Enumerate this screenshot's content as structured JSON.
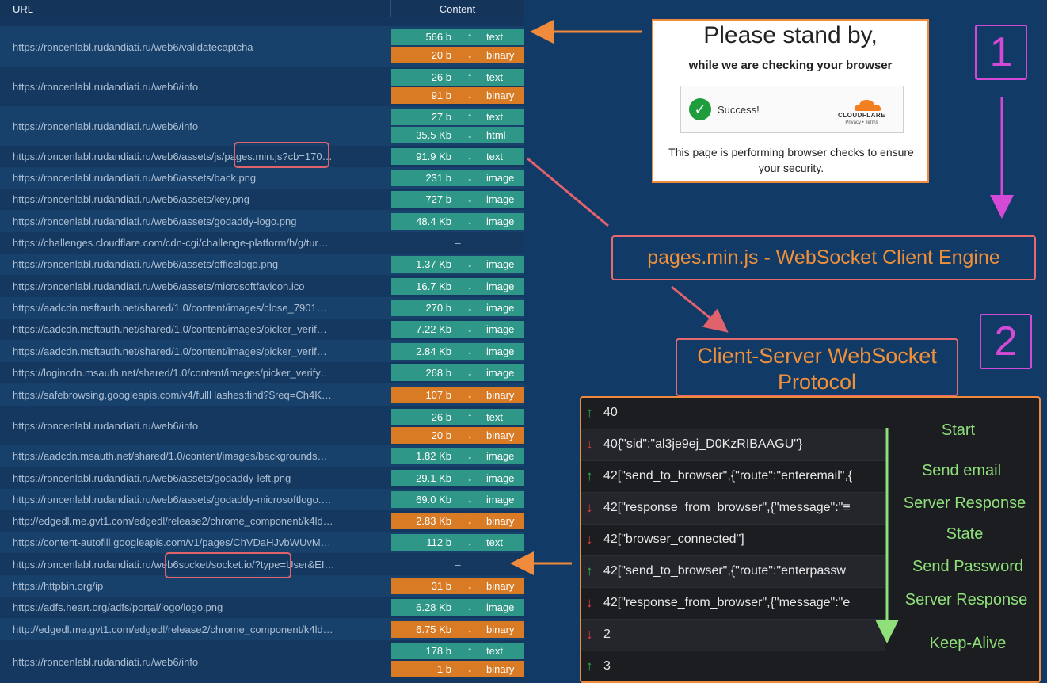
{
  "columns": {
    "url": "URL",
    "content": "Content"
  },
  "rows": [
    {
      "url": "https://roncenlabl.rudandiati.ru/web6/validatecaptcha",
      "chips": [
        {
          "size": "566 b",
          "dir": "up",
          "type": "text"
        },
        {
          "size": "20 b",
          "dir": "down",
          "type": "binary"
        }
      ]
    },
    {
      "url": "https://roncenlabl.rudandiati.ru/web6/info",
      "chips": [
        {
          "size": "26 b",
          "dir": "up",
          "type": "text"
        },
        {
          "size": "91 b",
          "dir": "down",
          "type": "binary"
        }
      ]
    },
    {
      "url": "https://roncenlabl.rudandiati.ru/web6/info",
      "chips": [
        {
          "size": "27 b",
          "dir": "up",
          "type": "text"
        },
        {
          "size": "35.5 Kb",
          "dir": "down",
          "type": "html"
        }
      ]
    },
    {
      "url": "https://roncenlabl.rudandiati.ru/web6/assets/js/pages.min.js?cb=170…",
      "chips": [
        {
          "size": "91.9 Kb",
          "dir": "down",
          "type": "text"
        }
      ]
    },
    {
      "url": "https://roncenlabl.rudandiati.ru/web6/assets/back.png",
      "chips": [
        {
          "size": "231 b",
          "dir": "down",
          "type": "image"
        }
      ]
    },
    {
      "url": "https://roncenlabl.rudandiati.ru/web6/assets/key.png",
      "chips": [
        {
          "size": "727 b",
          "dir": "down",
          "type": "image"
        }
      ]
    },
    {
      "url": "https://roncenlabl.rudandiati.ru/web6/assets/godaddy-logo.png",
      "chips": [
        {
          "size": "48.4 Kb",
          "dir": "down",
          "type": "image"
        }
      ]
    },
    {
      "url": "https://challenges.cloudflare.com/cdn-cgi/challenge-platform/h/g/tur…",
      "chips": [],
      "dash": "–"
    },
    {
      "url": "https://roncenlabl.rudandiati.ru/web6/assets/officelogo.png",
      "chips": [
        {
          "size": "1.37 Kb",
          "dir": "down",
          "type": "image"
        }
      ]
    },
    {
      "url": "https://roncenlabl.rudandiati.ru/web6/assets/microsoftfavicon.ico",
      "chips": [
        {
          "size": "16.7 Kb",
          "dir": "down",
          "type": "image"
        }
      ]
    },
    {
      "url": "https://aadcdn.msftauth.net/shared/1.0/content/images/close_7901…",
      "chips": [
        {
          "size": "270 b",
          "dir": "down",
          "type": "image"
        }
      ]
    },
    {
      "url": "https://aadcdn.msftauth.net/shared/1.0/content/images/picker_verif…",
      "chips": [
        {
          "size": "7.22 Kb",
          "dir": "down",
          "type": "image"
        }
      ]
    },
    {
      "url": "https://aadcdn.msftauth.net/shared/1.0/content/images/picker_verif…",
      "chips": [
        {
          "size": "2.84 Kb",
          "dir": "down",
          "type": "image"
        }
      ]
    },
    {
      "url": "https://logincdn.msauth.net/shared/1.0/content/images/picker_verify…",
      "chips": [
        {
          "size": "268 b",
          "dir": "down",
          "type": "image"
        }
      ]
    },
    {
      "url": "https://safebrowsing.googleapis.com/v4/fullHashes:find?$req=Ch4K…",
      "chips": [
        {
          "size": "107 b",
          "dir": "down",
          "type": "binary"
        }
      ]
    },
    {
      "url": "https://roncenlabl.rudandiati.ru/web6/info",
      "chips": [
        {
          "size": "26 b",
          "dir": "up",
          "type": "text"
        },
        {
          "size": "20 b",
          "dir": "down",
          "type": "binary"
        }
      ]
    },
    {
      "url": "https://aadcdn.msauth.net/shared/1.0/content/images/backgrounds…",
      "chips": [
        {
          "size": "1.82 Kb",
          "dir": "down",
          "type": "image"
        }
      ]
    },
    {
      "url": "https://roncenlabl.rudandiati.ru/web6/assets/godaddy-left.png",
      "chips": [
        {
          "size": "29.1 Kb",
          "dir": "down",
          "type": "image"
        }
      ]
    },
    {
      "url": "https://roncenlabl.rudandiati.ru/web6/assets/godaddy-microsoftlogo.…",
      "chips": [
        {
          "size": "69.0 Kb",
          "dir": "down",
          "type": "image"
        }
      ]
    },
    {
      "url": "http://edgedl.me.gvt1.com/edgedl/release2/chrome_component/k4ld…",
      "chips": [
        {
          "size": "2.83 Kb",
          "dir": "down",
          "type": "binary"
        }
      ]
    },
    {
      "url": "https://content-autofill.googleapis.com/v1/pages/ChVDaHJvbWUvM…",
      "chips": [
        {
          "size": "112 b",
          "dir": "down",
          "type": "text"
        }
      ]
    },
    {
      "url": "https://roncenlabl.rudandiati.ru/web6socket/socket.io/?type=User&EI…",
      "chips": [],
      "dash": "–"
    },
    {
      "url": "https://httpbin.org/ip",
      "chips": [
        {
          "size": "31 b",
          "dir": "down",
          "type": "binary"
        }
      ]
    },
    {
      "url": "https://adfs.heart.org/adfs/portal/logo/logo.png",
      "chips": [
        {
          "size": "6.28 Kb",
          "dir": "down",
          "type": "image"
        }
      ]
    },
    {
      "url": "http://edgedl.me.gvt1.com/edgedl/release2/chrome_component/k4ld…",
      "chips": [
        {
          "size": "6.75 Kb",
          "dir": "down",
          "type": "binary"
        }
      ]
    },
    {
      "url": "https://roncenlabl.rudandiati.ru/web6/info",
      "chips": [
        {
          "size": "178 b",
          "dir": "up",
          "type": "text"
        },
        {
          "size": "1 b",
          "dir": "down",
          "type": "binary"
        }
      ]
    }
  ],
  "cloudflare": {
    "title": "Please stand by,",
    "subtitle": "while we are checking your browser",
    "success": "Success!",
    "brand": "CLOUDFLARE",
    "privacy": "Privacy",
    "terms": "Terms",
    "note": "This page is performing browser checks to ensure your security."
  },
  "labels": {
    "step1": "1",
    "step2": "2",
    "engine": "pages.min.js - WebSocket Client Engine",
    "protocol": "Client-Server WebSocket Protocol"
  },
  "frames": [
    {
      "dir": "up",
      "msg": "40"
    },
    {
      "dir": "down",
      "msg": "40{\"sid\":\"al3je9ej_D0KzRIBAAGU\"}"
    },
    {
      "dir": "up",
      "msg": "42[\"send_to_browser\",{\"route\":\"enteremail\",{"
    },
    {
      "dir": "down",
      "msg": "42[\"response_from_browser\",{\"message\":\"≡"
    },
    {
      "dir": "down",
      "msg": "42[\"browser_connected\"]"
    },
    {
      "dir": "up",
      "msg": "42[\"send_to_browser\",{\"route\":\"enterpassw"
    },
    {
      "dir": "down",
      "msg": "42[\"response_from_browser\",{\"message\":\"e"
    },
    {
      "dir": "down",
      "msg": "2"
    },
    {
      "dir": "up",
      "msg": "3"
    }
  ],
  "steps": [
    "Start",
    "Send email",
    "Server Response",
    "State",
    "Send Password",
    "Server Response",
    "Keep-Alive"
  ],
  "colors": {
    "background": "#123a66",
    "chip_text": "#2e9787",
    "chip_binary": "#d97a25",
    "accent_orange": "#f08a3c",
    "accent_magenta": "#d44ad6",
    "accent_green": "#8fe07a",
    "highlight_red": "#e0626d"
  }
}
